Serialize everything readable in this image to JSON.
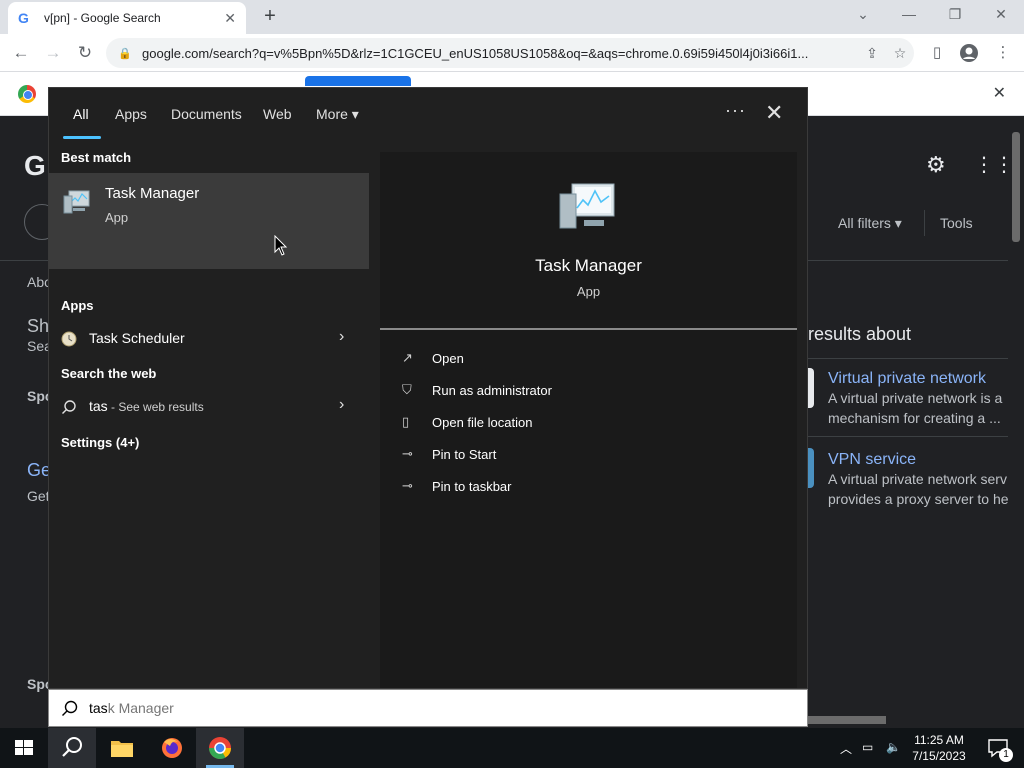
{
  "browser": {
    "tab_title": "v[pn] - Google Search",
    "url": "google.com/search?q=v%5Bpn%5D&rlz=1C1GCEU_enUS1058US1058&oq=&aqs=chrome.0.69i59i450l4j0i3i66i1..."
  },
  "google": {
    "logo": "G",
    "all_filters": "All filters",
    "tools": "Tools",
    "left_fragments": [
      "Abo",
      "Sh",
      "Sea",
      "Spo",
      "Ge",
      "Get",
      "Spo"
    ],
    "right_panel": {
      "header": "results about",
      "items": [
        {
          "title": "Virtual private network",
          "desc1": "A virtual private network is a",
          "desc2": "mechanism for creating a ..."
        },
        {
          "title": "VPN service",
          "desc1": "A virtual private network serv",
          "desc2": "provides a proxy server to he"
        }
      ]
    }
  },
  "search_flyout": {
    "tabs": [
      "All",
      "Apps",
      "Documents",
      "Web",
      "More"
    ],
    "active_tab": "All",
    "best_match_heading": "Best match",
    "best_match": {
      "name": "Task Manager",
      "type": "App"
    },
    "apps_heading": "Apps",
    "apps": [
      {
        "name": "Task Scheduler"
      }
    ],
    "web_heading": "Search the web",
    "web_query": "tas",
    "web_suffix": " - See web results",
    "settings_heading": "Settings (4+)",
    "preview": {
      "title": "Task Manager",
      "subtitle": "App",
      "actions": [
        "Open",
        "Run as administrator",
        "Open file location",
        "Pin to Start",
        "Pin to taskbar"
      ]
    },
    "search_box": {
      "typed": "tas",
      "suggestion": "k Manager"
    }
  },
  "taskbar": {
    "time": "11:25 AM",
    "date": "7/15/2023",
    "notification_count": "1"
  }
}
